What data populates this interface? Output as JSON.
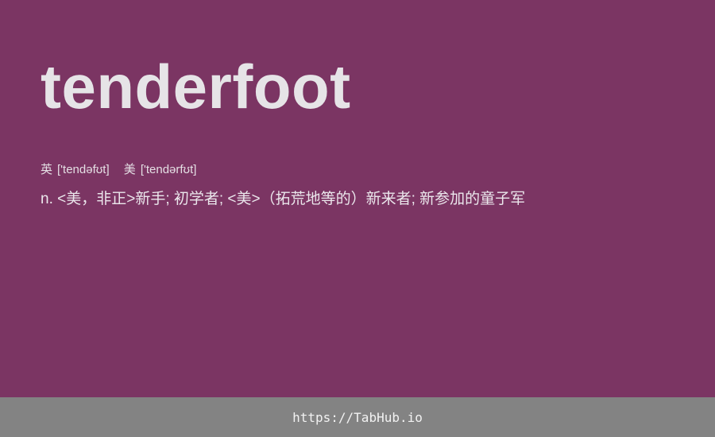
{
  "entry": {
    "word": "tenderfoot",
    "phonetics": [
      {
        "region": "英",
        "ipa": "['tendəfʊt]"
      },
      {
        "region": "美",
        "ipa": "['tendərfʊt]"
      }
    ],
    "definition": "n. <美，非正>新手; 初学者; <美>（拓荒地等的）新来者; 新参加的童子军"
  },
  "footer": {
    "link_text": "https://TabHub.io"
  },
  "colors": {
    "background": "#7b3563",
    "footer_bar": "#838383",
    "text": "#e9e6ea"
  }
}
